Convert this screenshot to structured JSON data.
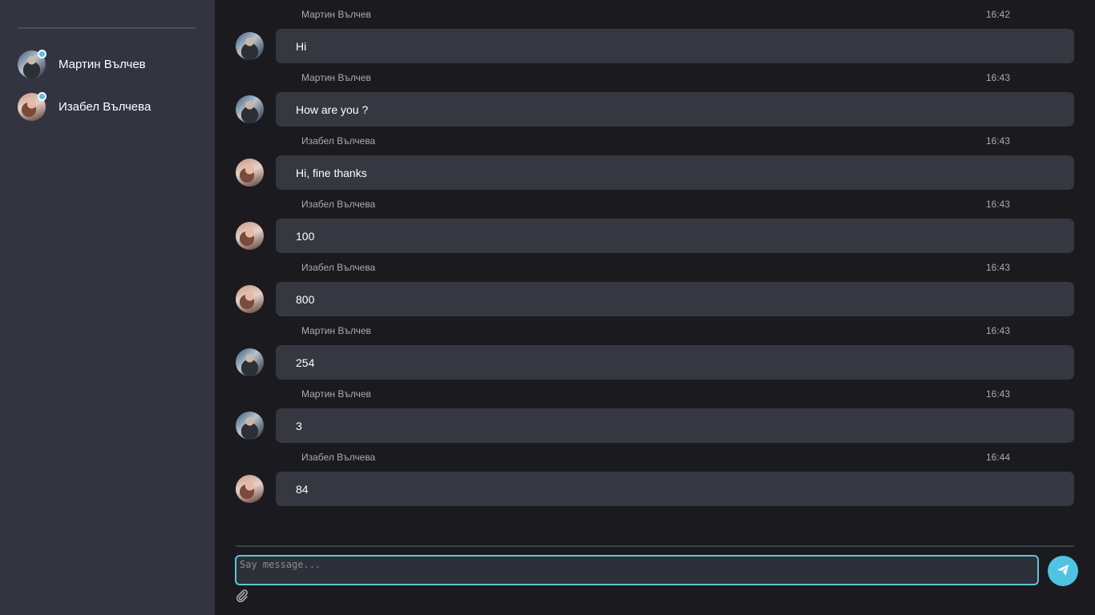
{
  "contacts": [
    {
      "name": "Мартин Вълчев",
      "avatar": "male-avatar",
      "online": true
    },
    {
      "name": "Изабел Вълчева",
      "avatar": "female-avatar",
      "online": true
    }
  ],
  "messages": [
    {
      "author": "Мартин Вълчев",
      "time": "16:42",
      "text": "Hi",
      "avatar": "male-avatar"
    },
    {
      "author": "Мартин Вълчев",
      "time": "16:43",
      "text": "How are you ?",
      "avatar": "male-avatar"
    },
    {
      "author": "Изабел Вълчева",
      "time": "16:43",
      "text": "Hi, fine thanks",
      "avatar": "female-avatar"
    },
    {
      "author": "Изабел Вълчева",
      "time": "16:43",
      "text": "100",
      "avatar": "female-avatar"
    },
    {
      "author": "Изабел Вълчева",
      "time": "16:43",
      "text": "800",
      "avatar": "female-avatar"
    },
    {
      "author": "Мартин Вълчев",
      "time": "16:43",
      "text": "254",
      "avatar": "male-avatar"
    },
    {
      "author": "Мартин Вълчев",
      "time": "16:43",
      "text": "3",
      "avatar": "male-avatar"
    },
    {
      "author": "Изабел Вълчева",
      "time": "16:44",
      "text": "84",
      "avatar": "female-avatar"
    }
  ],
  "composer": {
    "placeholder": "Say message...",
    "value": "",
    "send_icon": "paper-plane-icon",
    "attach_icon": "paperclip-icon"
  },
  "colors": {
    "accent": "#4fc3e2",
    "sidebar_bg": "#323540",
    "main_bg": "#1b1b1f",
    "bubble_bg": "#353840",
    "online": "#4fc3f7"
  }
}
